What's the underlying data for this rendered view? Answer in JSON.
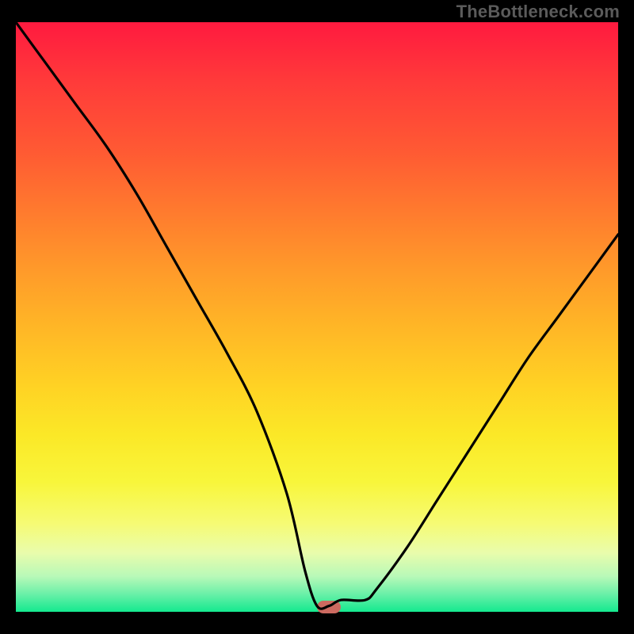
{
  "attribution": "TheBottleneck.com",
  "chart_data": {
    "type": "line",
    "title": "",
    "xlabel": "",
    "ylabel": "",
    "xlim": [
      0,
      100
    ],
    "ylim": [
      0,
      100
    ],
    "x": [
      0,
      5,
      10,
      15,
      20,
      25,
      30,
      35,
      40,
      45,
      48,
      50,
      52,
      54,
      58,
      60,
      65,
      70,
      75,
      80,
      85,
      90,
      95,
      100
    ],
    "values": [
      100,
      93,
      86,
      79,
      71,
      62,
      53,
      44,
      34,
      20,
      7,
      1,
      1,
      2,
      2,
      4,
      11,
      19,
      27,
      35,
      43,
      50,
      57,
      64
    ],
    "marker": {
      "x": 52,
      "y": 1
    },
    "gradient_stops": [
      {
        "pct": 0,
        "color": "#ff1a3f"
      },
      {
        "pct": 50,
        "color": "#ffb726"
      },
      {
        "pct": 80,
        "color": "#f8f63b"
      },
      {
        "pct": 100,
        "color": "#14e98f"
      }
    ]
  }
}
